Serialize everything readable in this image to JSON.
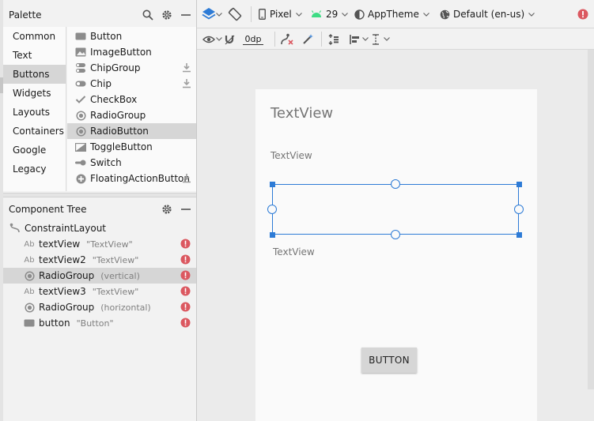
{
  "palette": {
    "title": "Palette",
    "categories": [
      {
        "label": "Common"
      },
      {
        "label": "Text"
      },
      {
        "label": "Buttons",
        "selected": true
      },
      {
        "label": "Widgets"
      },
      {
        "label": "Layouts"
      },
      {
        "label": "Containers"
      },
      {
        "label": "Google"
      },
      {
        "label": "Legacy"
      }
    ],
    "widgets": [
      {
        "label": "Button",
        "icon": "button-icon"
      },
      {
        "label": "ImageButton",
        "icon": "image-button-icon"
      },
      {
        "label": "ChipGroup",
        "icon": "chip-group-icon",
        "download": true
      },
      {
        "label": "Chip",
        "icon": "chip-icon",
        "download": true
      },
      {
        "label": "CheckBox",
        "icon": "checkbox-icon"
      },
      {
        "label": "RadioGroup",
        "icon": "radio-group-icon"
      },
      {
        "label": "RadioButton",
        "icon": "radio-button-icon",
        "selected": true
      },
      {
        "label": "ToggleButton",
        "icon": "toggle-button-icon"
      },
      {
        "label": "Switch",
        "icon": "switch-icon"
      },
      {
        "label": "FloatingActionButton",
        "icon": "fab-icon",
        "download": true
      }
    ]
  },
  "component_tree": {
    "title": "Component Tree",
    "root": {
      "label": "ConstraintLayout",
      "icon": "constraint-layout-icon"
    },
    "items": [
      {
        "label": "textView",
        "sub": "\"TextView\"",
        "icon": "text-view-icon"
      },
      {
        "label": "textView2",
        "sub": "\"TextView\"",
        "icon": "text-view-icon"
      },
      {
        "label": "RadioGroup",
        "sub": "(vertical)",
        "icon": "radio-group-icon",
        "selected": true
      },
      {
        "label": "textView3",
        "sub": "\"TextView\"",
        "icon": "text-view-icon"
      },
      {
        "label": "RadioGroup",
        "sub": "(horizontal)",
        "icon": "radio-group-icon"
      },
      {
        "label": "button",
        "sub": "\"Button\"",
        "icon": "button-icon"
      }
    ]
  },
  "toolbar": {
    "device": "Pixel",
    "api_level": "29",
    "theme": "AppTheme",
    "locale": "Default (en-us)",
    "margin": "0dp"
  },
  "canvas": {
    "text_title": "TextView",
    "text_small_1": "TextView",
    "text_small_2": "TextView",
    "button_label": "BUTTON"
  },
  "colors": {
    "accent": "#2d7bd6",
    "error": "#db5860",
    "android_green": "#3ddc84"
  }
}
